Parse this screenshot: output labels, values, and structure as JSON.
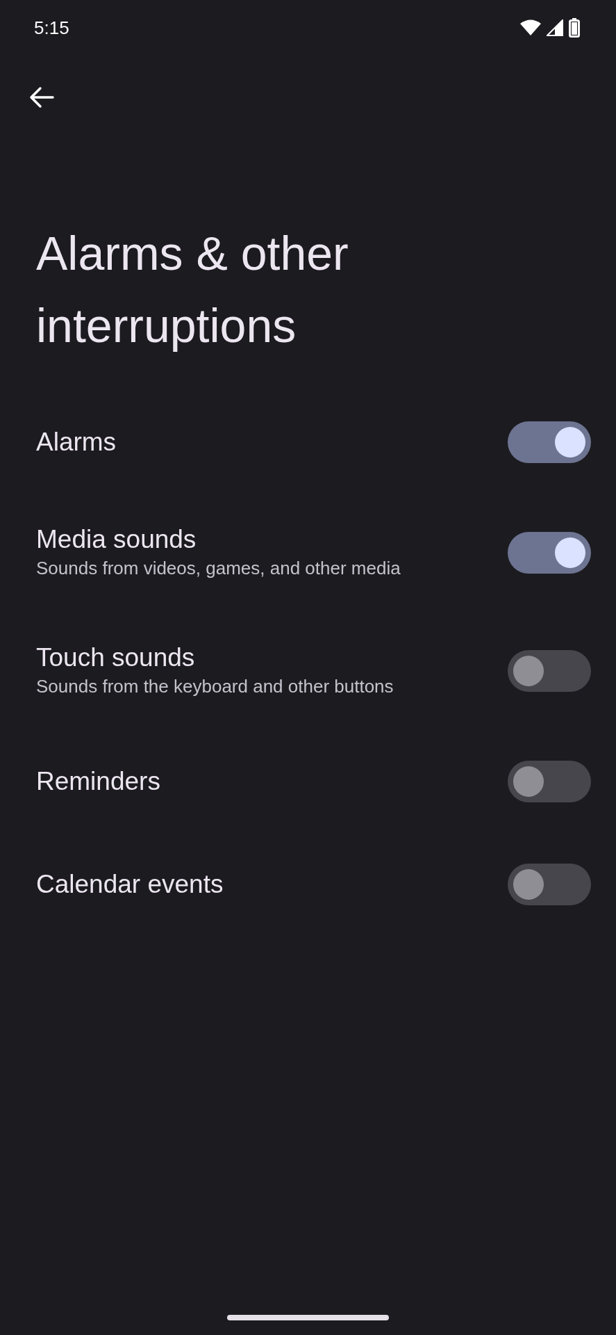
{
  "status_bar": {
    "time": "5:15"
  },
  "title": "Alarms & other interruptions",
  "settings": [
    {
      "label": "Alarms",
      "checked": true
    },
    {
      "label": "Media sounds",
      "summary": "Sounds from videos, games, and other media",
      "checked": true
    },
    {
      "label": "Touch sounds",
      "summary": "Sounds from the keyboard and other buttons",
      "checked": false
    },
    {
      "label": "Reminders",
      "checked": false
    },
    {
      "label": "Calendar events",
      "checked": false
    }
  ]
}
